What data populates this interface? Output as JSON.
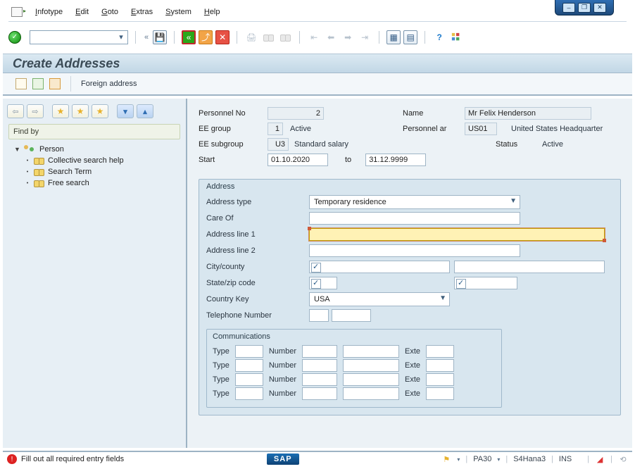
{
  "menu": {
    "items": [
      "Infotype",
      "Edit",
      "Goto",
      "Extras",
      "System",
      "Help"
    ]
  },
  "page": {
    "title": "Create Addresses"
  },
  "sub_toolbar": {
    "foreign_address": "Foreign address"
  },
  "left_panel": {
    "find_by_label": "Find by",
    "root": "Person",
    "children": [
      "Collective search help",
      "Search Term",
      "Free search"
    ]
  },
  "header": {
    "personnel_no_label": "Personnel No",
    "personnel_no_value": "2",
    "name_label": "Name",
    "name_value": "Mr Felix Henderson",
    "ee_group_label": "EE group",
    "ee_group_code": "1",
    "ee_group_text": "Active",
    "personnel_area_label": "Personnel ar",
    "personnel_area_code": "US01",
    "personnel_area_text": "United States Headquarter",
    "ee_subgroup_label": "EE subgroup",
    "ee_subgroup_code": "U3",
    "ee_subgroup_text": "Standard salary",
    "status_label": "Status",
    "status_value": "Active",
    "start_label": "Start",
    "start_value": "01.10.2020",
    "to_label": "to",
    "end_value": "31.12.9999"
  },
  "address_group": {
    "title": "Address",
    "address_type_label": "Address type",
    "address_type_value": "Temporary residence",
    "care_of_label": "Care Of",
    "care_of_value": "",
    "addr1_label": "Address line 1",
    "addr1_value": "",
    "addr2_label": "Address line 2",
    "addr2_value": "",
    "city_label": "City/county",
    "city_value": "",
    "county_value": "",
    "state_label": "State/zip code",
    "state_value": "",
    "zip_value": "",
    "country_label": "Country Key",
    "country_value": "USA",
    "tel_label": "Telephone Number",
    "tel_prefix": "",
    "tel_number": ""
  },
  "communications_group": {
    "title": "Communications",
    "type_label": "Type",
    "number_label": "Number",
    "ext_label": "Exte",
    "rows": [
      {
        "type": "",
        "number_a": "",
        "number_b": "",
        "ext": ""
      },
      {
        "type": "",
        "number_a": "",
        "number_b": "",
        "ext": ""
      },
      {
        "type": "",
        "number_a": "",
        "number_b": "",
        "ext": ""
      },
      {
        "type": "",
        "number_a": "",
        "number_b": "",
        "ext": ""
      }
    ]
  },
  "status_bar": {
    "message": "Fill out all required entry fields",
    "brand": "SAP",
    "transaction": "PA30",
    "system": "S4Hana3",
    "mode": "INS"
  }
}
